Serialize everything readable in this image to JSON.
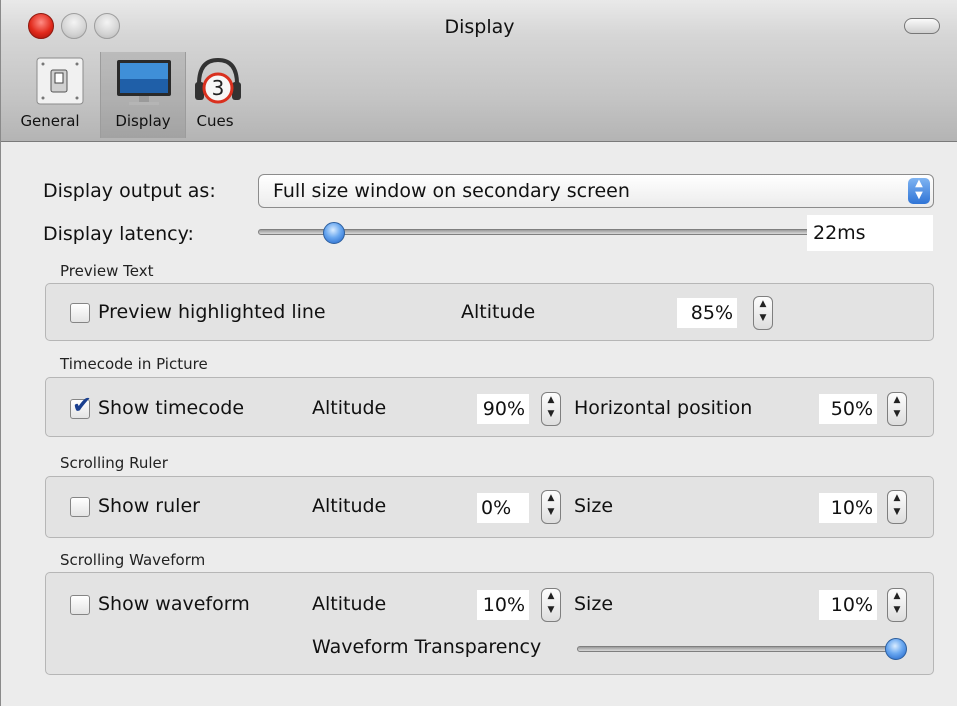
{
  "window": {
    "title": "Display"
  },
  "toolbar": {
    "items": [
      {
        "label": "General",
        "icon": "switch-icon"
      },
      {
        "label": "Display",
        "icon": "monitor-icon",
        "selected": true
      },
      {
        "label": "Cues",
        "icon": "headphones-cue-icon",
        "badge": "3"
      }
    ]
  },
  "display_output": {
    "label": "Display output as:",
    "value": "Full size window on secondary screen"
  },
  "display_latency": {
    "label": "Display latency:",
    "value": "22ms",
    "slider_fraction": 0.12
  },
  "preview_text": {
    "title": "Preview Text",
    "checkbox_label": "Preview highlighted line",
    "checked": false,
    "altitude_label": "Altitude",
    "altitude_value": "85%"
  },
  "timecode": {
    "title": "Timecode in Picture",
    "checkbox_label": "Show timecode",
    "checked": true,
    "altitude_label": "Altitude",
    "altitude_value": "90%",
    "horizontal_label": "Horizontal position",
    "horizontal_value": "50%"
  },
  "ruler": {
    "title": "Scrolling Ruler",
    "checkbox_label": "Show ruler",
    "checked": false,
    "altitude_label": "Altitude",
    "altitude_value": "0%",
    "size_label": "Size",
    "size_value": "10%"
  },
  "waveform": {
    "title": "Scrolling Waveform",
    "checkbox_label": "Show waveform",
    "checked": false,
    "altitude_label": "Altitude",
    "altitude_value": "10%",
    "size_label": "Size",
    "size_value": "10%",
    "transparency_label": "Waveform Transparency",
    "transparency_fraction": 1.0
  }
}
